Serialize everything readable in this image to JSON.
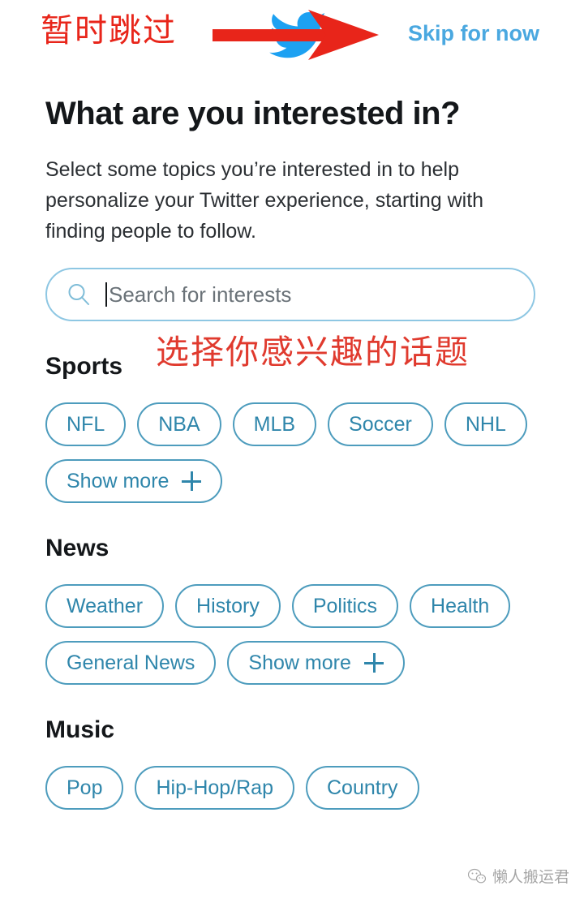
{
  "annotations": {
    "skip_cn": "暂时跳过",
    "topics_cn": "选择你感兴趣的话题",
    "arrow_color": "#e8251a",
    "cn_text_color": "#e03a2e"
  },
  "topbar": {
    "skip_label": "Skip for now",
    "skip_color": "#4aa8e0",
    "logo_name": "twitter-bird-logo",
    "logo_color": "#1da1f2"
  },
  "main": {
    "title": "What are you interested in?",
    "description": "Select some topics you’re interested in to help personalize your Twitter experience, starting with finding people to follow."
  },
  "search": {
    "placeholder": "Search for interests",
    "value": "",
    "icon": "search-icon",
    "border_color": "#8ec7e3"
  },
  "chip_style": {
    "border_color": "#4d9cbd",
    "text_color": "#2f86ab"
  },
  "sections": [
    {
      "title": "Sports",
      "chips": [
        {
          "label": "NFL",
          "has_plus": false
        },
        {
          "label": "NBA",
          "has_plus": false
        },
        {
          "label": "MLB",
          "has_plus": false
        },
        {
          "label": "Soccer",
          "has_plus": false
        },
        {
          "label": "NHL",
          "has_plus": false
        },
        {
          "label": "Show more",
          "has_plus": true
        }
      ]
    },
    {
      "title": "News",
      "chips": [
        {
          "label": "Weather",
          "has_plus": false
        },
        {
          "label": "History",
          "has_plus": false
        },
        {
          "label": "Politics",
          "has_plus": false
        },
        {
          "label": "Health",
          "has_plus": false
        },
        {
          "label": "General News",
          "has_plus": false
        },
        {
          "label": "Show more",
          "has_plus": true
        }
      ]
    },
    {
      "title": "Music",
      "chips": [
        {
          "label": "Pop",
          "has_plus": false
        },
        {
          "label": "Hip-Hop/Rap",
          "has_plus": false
        },
        {
          "label": "Country",
          "has_plus": false
        }
      ]
    }
  ],
  "watermark": {
    "text": "懒人搬运君",
    "icon": "wechat-icon"
  }
}
